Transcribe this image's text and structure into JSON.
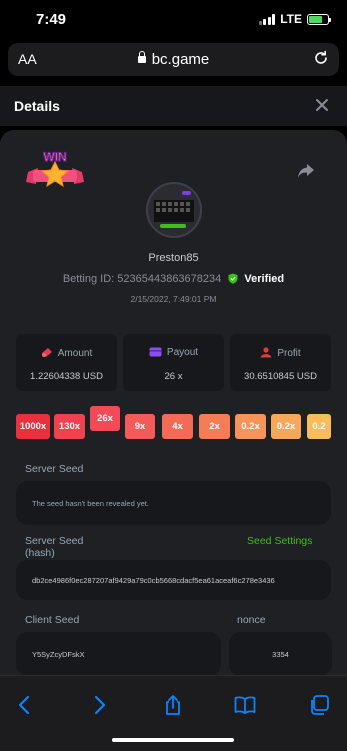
{
  "status_bar": {
    "time": "7:49",
    "network": "LTE"
  },
  "browser": {
    "text_size": "AA",
    "url": "bc.game"
  },
  "header": {
    "title": "Details"
  },
  "bet": {
    "badge": "WIN",
    "avatar_caption": "Dice",
    "username": "Preston85",
    "betting_id": "Betting ID: 52365443863678234",
    "verified": "Verified",
    "date": "2/15/2022, 7:49:01 PM"
  },
  "stats": [
    {
      "label": "Amount",
      "value": "1.22604338 USD"
    },
    {
      "label": "Payout",
      "value": "26 x"
    },
    {
      "label": "Profit",
      "value": "30.6510845 USD"
    }
  ],
  "multipliers": [
    {
      "label": "1000x",
      "color": "#e8303f"
    },
    {
      "label": "130x",
      "color": "#f0414e"
    },
    {
      "label": "26x",
      "color": "#f24a56"
    },
    {
      "label": "9x",
      "color": "#f35a5a"
    },
    {
      "label": "4x",
      "color": "#f36b57"
    },
    {
      "label": "2x",
      "color": "#f47d55"
    },
    {
      "label": "0.2x",
      "color": "#f59358"
    },
    {
      "label": "0.2x",
      "color": "#f6a85a"
    },
    {
      "label": "0.2",
      "color": "#f7bc5c"
    }
  ],
  "server_seed": {
    "label": "Server Seed",
    "value": "The seed hasn't been revealed yet."
  },
  "server_seed_hash": {
    "label_line1": "Server Seed",
    "label_line2": "(hash)",
    "action": "Seed Settings",
    "value": "db2ce4986f0ec287207af9429a79c0cb5668cdacf5ea61aceaf6c278e3436"
  },
  "client_seed": {
    "label": "Client Seed",
    "value": "Y5SyZcyDFskX"
  },
  "nonce": {
    "label": "nonce",
    "value": "3354"
  },
  "toolbar": [
    "back-icon",
    "forward-icon",
    "share-icon",
    "bookmarks-icon",
    "tabs-icon"
  ],
  "colors": {
    "accent_green": "#3bc117",
    "panel": "#1e2024",
    "card": "#17181b"
  }
}
